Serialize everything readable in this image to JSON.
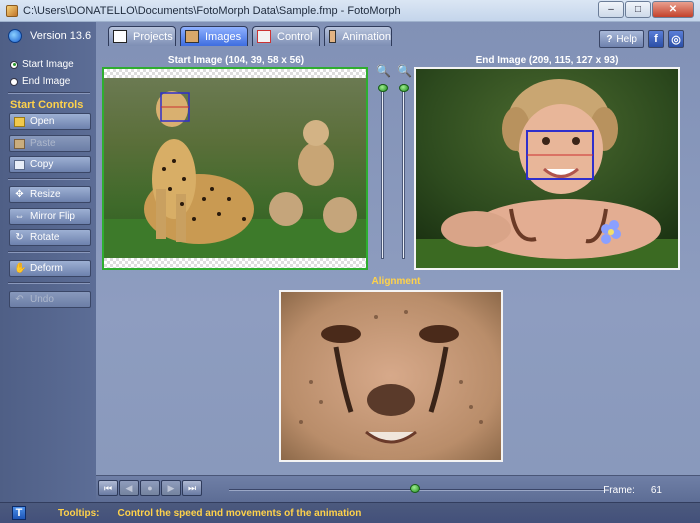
{
  "window": {
    "title": "C:\\Users\\DONATELLO\\Documents\\FotoMorph Data\\Sample.fmp - FotoMorph",
    "minimize": "–",
    "maximize": "□",
    "close": "✕"
  },
  "sidebar": {
    "version": "Version 13.6",
    "radios": [
      "Start Image",
      "End Image"
    ],
    "section_title": "Start Controls",
    "buttons": {
      "open": "Open",
      "paste": "Paste",
      "copy": "Copy",
      "resize": "Resize",
      "mirror_flip": "Mirror Flip",
      "rotate": "Rotate",
      "deform": "Deform",
      "undo": "Undo"
    }
  },
  "tabs": [
    "Projects",
    "Images",
    "Control",
    "Animation"
  ],
  "active_tab": "Images",
  "top_buttons": {
    "help": "Help",
    "facebook": "f",
    "web": "◎"
  },
  "start_image": {
    "caption": "Start Image (104, 39, 58 x 56)"
  },
  "end_image": {
    "caption": "End Image (209, 115, 127 x 93)"
  },
  "alignment": {
    "caption": "Alignment"
  },
  "playback": {
    "buttons": [
      "⏮",
      "◀",
      "●",
      "▶",
      "⏭"
    ],
    "frame_label": "Frame:",
    "frame_value": "61",
    "position": 0.49
  },
  "status": {
    "label": "Tooltips:",
    "text": "Control the speed and movements of the animation"
  },
  "colors": {
    "accent": "#ffd24a",
    "active_tab": "#3e6ddf",
    "selection": "#2f2fcc",
    "start_frame_border": "#2fae2f"
  }
}
